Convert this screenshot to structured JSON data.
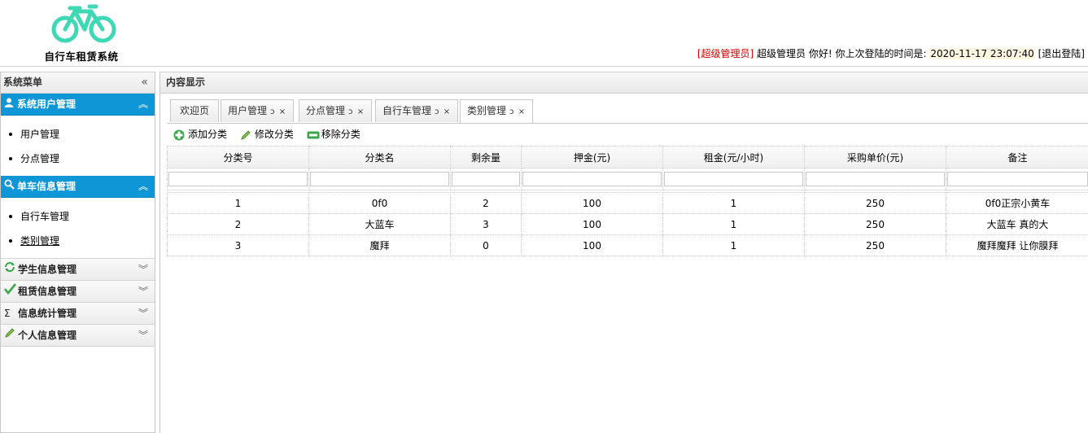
{
  "app": {
    "title": "自行车租赁系统"
  },
  "userbar": {
    "role": "[超级管理员]",
    "greeting": " 超级管理员 你好! 你上次登陆的时间是: ",
    "last_login": "2020-11-17 23:07:40",
    "logout": " [退出登陆]"
  },
  "sidebar": {
    "title": "系统菜单",
    "collapse_icon": "«",
    "sections": [
      {
        "label": "系统用户管理",
        "icon": "user-icon",
        "items": [
          "用户管理",
          "分点管理"
        ]
      },
      {
        "label": "单车信息管理",
        "icon": "search-icon",
        "items": [
          "自行车管理",
          "类别管理"
        ]
      }
    ],
    "closed": [
      {
        "label": "学生信息管理",
        "icon": "refresh-icon"
      },
      {
        "label": "租赁信息管理",
        "icon": "check-icon"
      },
      {
        "label": "信息统计管理",
        "icon": "sigma-icon"
      },
      {
        "label": "个人信息管理",
        "icon": "pencil-icon"
      }
    ]
  },
  "main": {
    "title": "内容显示",
    "tabs": [
      {
        "label": "欢迎页"
      },
      {
        "label": "用户管理"
      },
      {
        "label": "分点管理"
      },
      {
        "label": "自行车管理"
      },
      {
        "label": "类别管理"
      }
    ],
    "tab_ops": "ↄ ×",
    "toolbar": {
      "add": "添加分类",
      "edit": "修改分类",
      "remove": "移除分类"
    },
    "table": {
      "columns": [
        "分类号",
        "分类名",
        "剩余量",
        "押金(元)",
        "租金(元/小时)",
        "采购单价(元)",
        "备注"
      ],
      "rows": [
        [
          "1",
          "0f0",
          "2",
          "100",
          "1",
          "250",
          "0f0正宗小黄车"
        ],
        [
          "2",
          "大蓝车",
          "3",
          "100",
          "1",
          "250",
          "大蓝车 真的大"
        ],
        [
          "3",
          "魔拜",
          "0",
          "100",
          "1",
          "250",
          "魔拜魔拜 让你膜拜"
        ]
      ]
    }
  },
  "colors": {
    "accent": "#0f96d6",
    "logo": "#3ed8b4",
    "role": "#d40000"
  }
}
